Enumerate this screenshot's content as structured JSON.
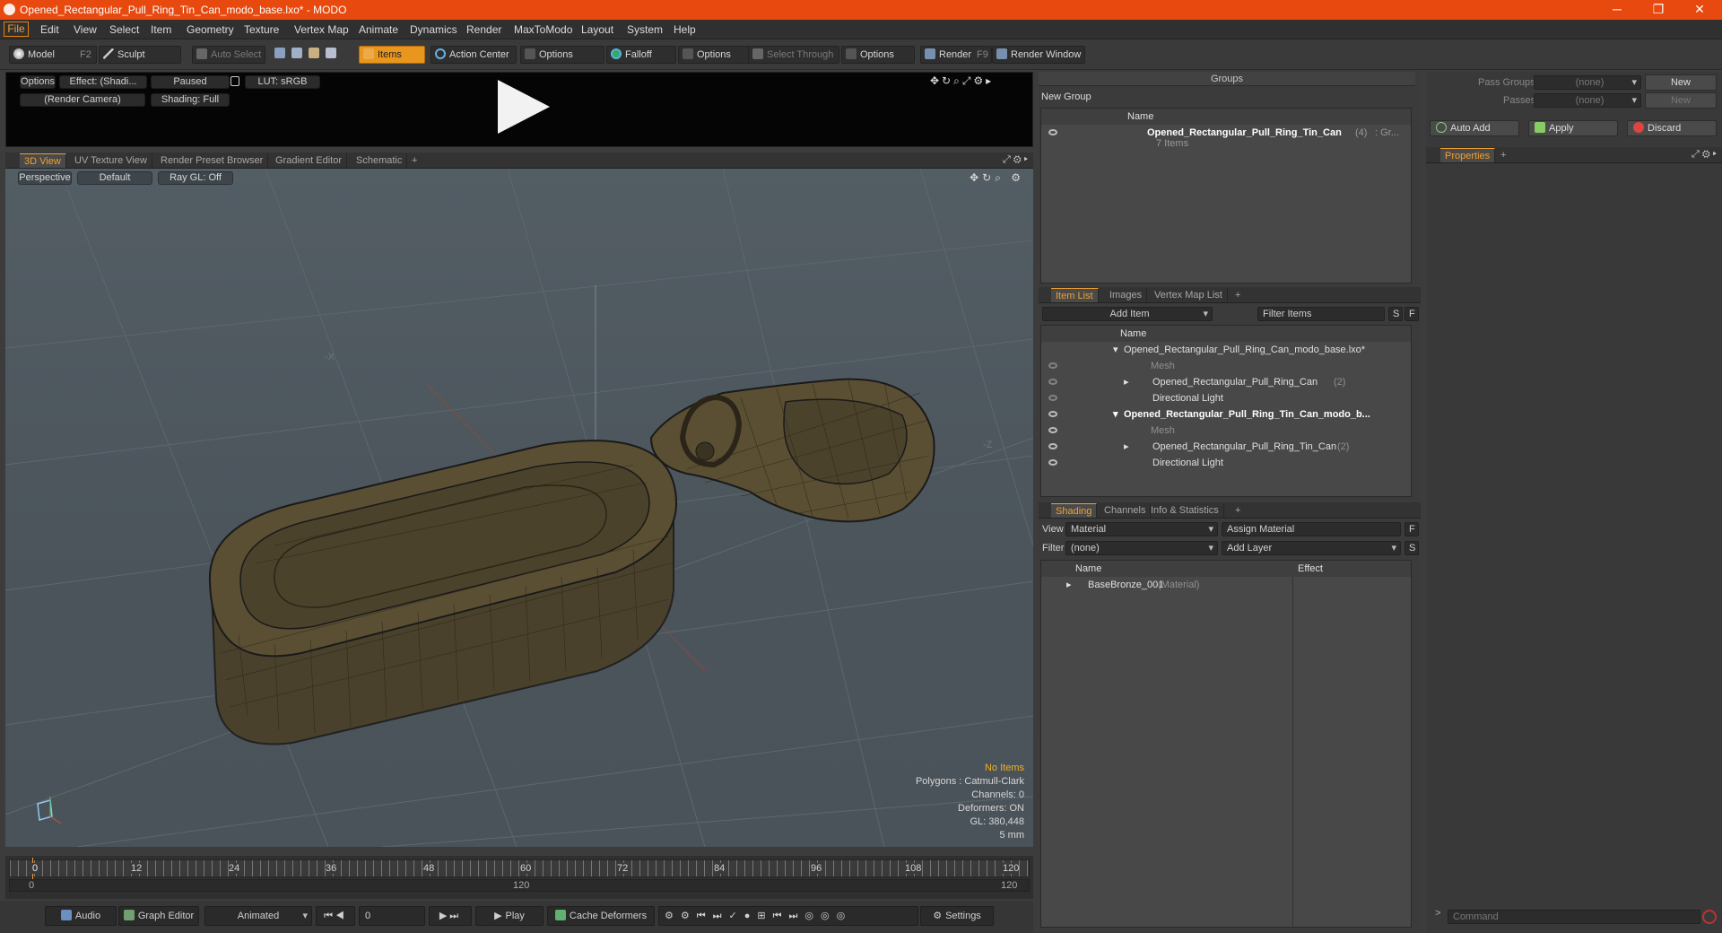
{
  "window": {
    "title": "Opened_Rectangular_Pull_Ring_Tin_Can_modo_base.lxo* - MODO",
    "minimize": "─",
    "restore": "❐",
    "close": "✕"
  },
  "menu": [
    "File",
    "Edit",
    "View",
    "Select",
    "Item",
    "Geometry",
    "Texture",
    "Vertex Map",
    "Animate",
    "Dynamics",
    "Render",
    "MaxToModo",
    "Layout",
    "System",
    "Help"
  ],
  "toolbar": {
    "model": "Model",
    "model_key": "F2",
    "sculpt": "Sculpt",
    "auto_select": "Auto Select",
    "items": "Items",
    "action_center": "Action Center",
    "options1": "Options",
    "falloff": "Falloff",
    "options2": "Options",
    "select_through": "Select Through",
    "options3": "Options",
    "render": "Render",
    "render_key": "F9",
    "render_window": "Render Window"
  },
  "preview": {
    "options": "Options",
    "effect": "Effect: (Shadi...",
    "paused": "Paused",
    "lut": "LUT: sRGB",
    "camera": "(Render Camera)",
    "shading": "Shading: Full"
  },
  "viewport_tabs": [
    "3D View",
    "UV Texture View",
    "Render Preset Browser",
    "Gradient Editor",
    "Schematic",
    "+"
  ],
  "viewport": {
    "perspective": "Perspective",
    "default": "Default",
    "raygl": "Ray GL: Off",
    "axis_x": "-X",
    "axis_z": "-Z",
    "stats": {
      "no_items": "No Items",
      "polygons": "Polygons : Catmull-Clark",
      "channels": "Channels: 0",
      "deformers": "Deformers: ON",
      "gl": "GL: 380,448",
      "unit": "5 mm"
    }
  },
  "timeline": {
    "ticks": [
      "0",
      "12",
      "24",
      "36",
      "48",
      "60",
      "72",
      "84",
      "96",
      "108",
      "120"
    ],
    "sub_left": "0",
    "sub_mid": "120",
    "sub_right": "120"
  },
  "transport": {
    "audio": "Audio",
    "graph_editor": "Graph Editor",
    "animated": "Animated",
    "frame": "0",
    "play": "Play",
    "cache_deformers": "Cache Deformers",
    "settings": "Settings"
  },
  "groups": {
    "title": "Groups",
    "new_group": "New Group",
    "col_name": "Name",
    "item_name": "Opened_Rectangular_Pull_Ring_Tin_Can",
    "item_count": "(4)",
    "item_suffix": ": Gr...",
    "item_sub": "7 Items"
  },
  "item_list": {
    "tabs": [
      "Item List",
      "Images",
      "Vertex Map List",
      "+"
    ],
    "add_item": "Add Item",
    "filter": "Filter Items",
    "s": "S",
    "f": "F",
    "col_name": "Name",
    "rows": [
      {
        "name": "Opened_Rectangular_Pull_Ring_Can_modo_base.lxo*",
        "extra": ""
      },
      {
        "name": "Mesh",
        "extra": ""
      },
      {
        "name": "Opened_Rectangular_Pull_Ring_Can",
        "extra": "(2)"
      },
      {
        "name": "Directional Light",
        "extra": ""
      },
      {
        "name": "Opened_Rectangular_Pull_Ring_Tin_Can_modo_b...",
        "extra": ""
      },
      {
        "name": "Mesh",
        "extra": ""
      },
      {
        "name": "Opened_Rectangular_Pull_Ring_Tin_Can",
        "extra": "(2)"
      },
      {
        "name": "Directional Light",
        "extra": ""
      }
    ]
  },
  "shading": {
    "tabs": [
      "Shading",
      "Channels",
      "Info & Statistics",
      "+"
    ],
    "view_label": "View",
    "view_value": "Material",
    "assign": "Assign Material",
    "filter_label": "Filter",
    "filter_value": "(none)",
    "add_layer": "Add Layer",
    "f": "F",
    "s": "S",
    "col_name": "Name",
    "col_effect": "Effect",
    "row_name": "BaseBronze_001",
    "row_type": "(Material)"
  },
  "right": {
    "pass_groups": "Pass Groups",
    "passes": "Passes",
    "none1": "(none)",
    "none2": "(none)",
    "new1": "New",
    "new2": "New",
    "auto_add": "Auto Add",
    "apply": "Apply",
    "discard": "Discard",
    "properties": "Properties",
    "plus": "+",
    "command": "Command"
  }
}
